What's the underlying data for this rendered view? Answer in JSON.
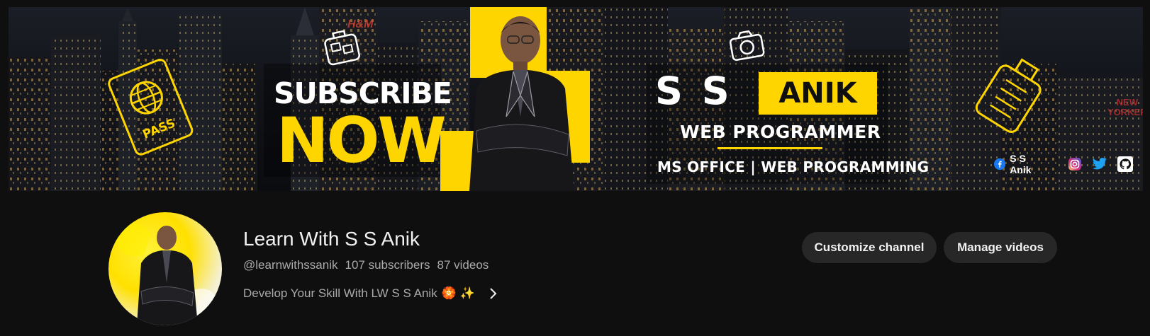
{
  "banner": {
    "subscribe_line": "SUBSCRIBE",
    "now_line": "NOW",
    "pass_label": "PASS",
    "name_first": "S S",
    "name_last": "ANIK",
    "role": "WEB PROGRAMMER",
    "skills": "MS OFFICE | WEB PROGRAMMING",
    "social_name": "S S Anik",
    "sign_text_line1": "NEW",
    "sign_text_line2": "YORKER",
    "store_sign": "H&M",
    "accent_color": "#ffd500"
  },
  "channel": {
    "title": "Learn With S S Anik",
    "handle": "@learnwithssanik",
    "subscribers": "107 subscribers",
    "videos": "87 videos",
    "description": "Develop Your Skill With LW S S Anik",
    "description_emoji": "🏵️ ✨"
  },
  "buttons": {
    "customize": "Customize channel",
    "manage": "Manage videos"
  },
  "icons": {
    "social": [
      "facebook-icon",
      "instagram-icon",
      "twitter-icon",
      "github-icon"
    ],
    "banner_decor": [
      "passport-icon",
      "luggage-icon",
      "camera-icon",
      "suitcase-icon"
    ]
  }
}
